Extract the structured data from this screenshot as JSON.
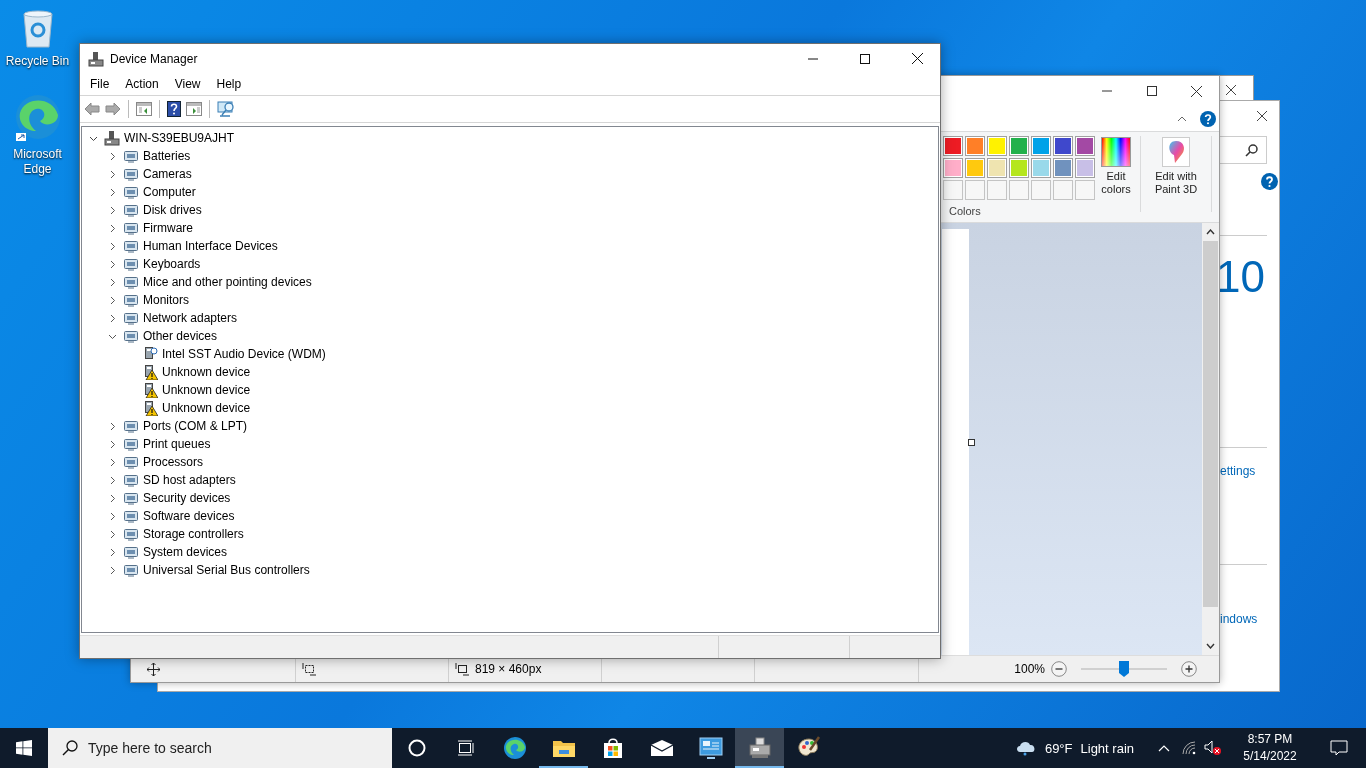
{
  "desktop_icons": [
    {
      "label": "Recycle Bin",
      "kind": "bin"
    },
    {
      "label": "Microsoft Edge",
      "kind": "browser"
    }
  ],
  "settings_window": {
    "big_text": "10",
    "links": [
      "ettings",
      "indows"
    ]
  },
  "paint_window": {
    "palette": [
      {
        "kind": "filled",
        "color": "#ed1c24"
      },
      {
        "kind": "filled",
        "color": "#ff7f27"
      },
      {
        "kind": "filled",
        "color": "#fff200"
      },
      {
        "kind": "filled",
        "color": "#22b14c"
      },
      {
        "kind": "filled",
        "color": "#00a2e8"
      },
      {
        "kind": "filled",
        "color": "#3f48cc"
      },
      {
        "kind": "filled",
        "color": "#a349a4"
      },
      {
        "kind": "filled",
        "color": "#ffaec9"
      },
      {
        "kind": "filled",
        "color": "#ffc90e"
      },
      {
        "kind": "filled",
        "color": "#efe4b0"
      },
      {
        "kind": "filled",
        "color": "#b5e61d"
      },
      {
        "kind": "filled",
        "color": "#99d9ea"
      },
      {
        "kind": "filled",
        "color": "#7092be"
      },
      {
        "kind": "filled",
        "color": "#c8bfe7"
      },
      {
        "kind": "empty"
      },
      {
        "kind": "empty"
      },
      {
        "kind": "empty"
      },
      {
        "kind": "empty"
      },
      {
        "kind": "empty"
      },
      {
        "kind": "empty"
      },
      {
        "kind": "empty"
      }
    ],
    "group_label": "Colors",
    "edit_colors": "Edit colors",
    "edit_3d": "Edit with Paint 3D",
    "status": {
      "size": "819 × 460px",
      "zoom": "100%"
    },
    "zoom_slider": {
      "level": 0.5
    }
  },
  "device_manager": {
    "title": "Device Manager",
    "menu": [
      "File",
      "Action",
      "View",
      "Help"
    ],
    "tree": {
      "label": "WIN-S39EBU9AJHT",
      "expanded": true,
      "children": [
        {
          "label": "Batteries",
          "expanded": false
        },
        {
          "label": "Cameras",
          "expanded": false
        },
        {
          "label": "Computer",
          "expanded": false
        },
        {
          "label": "Disk drives",
          "expanded": false
        },
        {
          "label": "Firmware",
          "expanded": false
        },
        {
          "label": "Human Interface Devices",
          "expanded": false
        },
        {
          "label": "Keyboards",
          "expanded": false
        },
        {
          "label": "Mice and other pointing devices",
          "expanded": false
        },
        {
          "label": "Monitors",
          "expanded": false
        },
        {
          "label": "Network adapters",
          "expanded": false
        },
        {
          "label": "Other devices",
          "expanded": true,
          "children": [
            {
              "label": "Intel SST Audio Device (WDM)",
              "warning": false
            },
            {
              "label": "Unknown device",
              "warning": true
            },
            {
              "label": "Unknown device",
              "warning": true
            },
            {
              "label": "Unknown device",
              "warning": true
            }
          ]
        },
        {
          "label": "Ports (COM & LPT)",
          "expanded": false
        },
        {
          "label": "Print queues",
          "expanded": false
        },
        {
          "label": "Processors",
          "expanded": false
        },
        {
          "label": "SD host adapters",
          "expanded": false
        },
        {
          "label": "Security devices",
          "expanded": false
        },
        {
          "label": "Software devices",
          "expanded": false
        },
        {
          "label": "Storage controllers",
          "expanded": false
        },
        {
          "label": "System devices",
          "expanded": false
        },
        {
          "label": "Universal Serial Bus controllers",
          "expanded": false
        }
      ]
    }
  },
  "taskbar": {
    "search_placeholder": "Type here to search",
    "apps": [
      {
        "kind": "cortana",
        "open": false,
        "selected": false
      },
      {
        "kind": "taskview",
        "open": false,
        "selected": false
      },
      {
        "kind": "edge",
        "open": false,
        "selected": false
      },
      {
        "kind": "explorer",
        "open": true,
        "selected": false
      },
      {
        "kind": "store",
        "open": false,
        "selected": false
      },
      {
        "kind": "mail",
        "open": false,
        "selected": false
      },
      {
        "kind": "remote",
        "open": false,
        "selected": false
      },
      {
        "kind": "devmgr",
        "open": true,
        "selected": true
      },
      {
        "kind": "paint",
        "open": false,
        "selected": false
      }
    ],
    "temperature": "69°F",
    "weather": "Light rain",
    "time": "8:57 PM",
    "date": "5/14/2022"
  }
}
